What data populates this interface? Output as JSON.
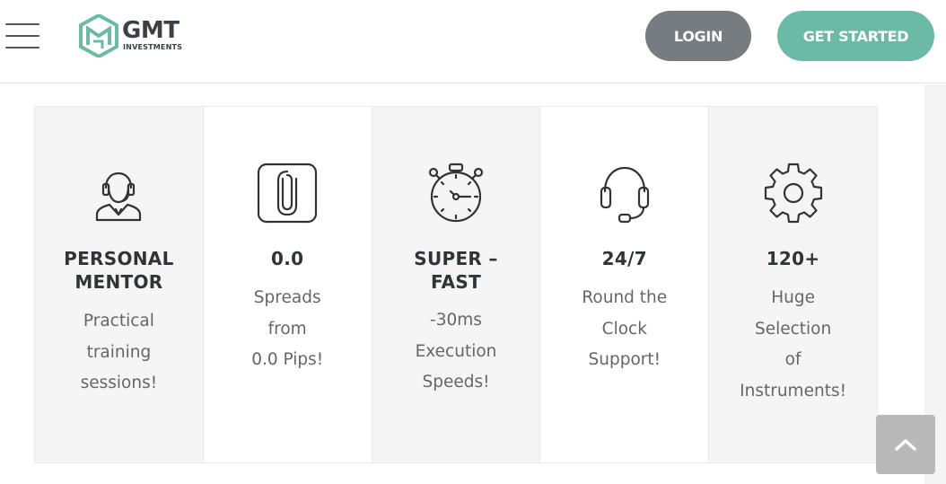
{
  "header": {
    "logo": {
      "name": "GMT",
      "subtitle": "INVESTMENTS",
      "icon": "gmt-hex-logo"
    },
    "menu_icon": "hamburger-menu-icon",
    "login_label": "LOGIN",
    "get_started_label": "GET STARTED"
  },
  "colors": {
    "brand": "#6abaa5",
    "login_button": "#767c7f",
    "panel_shade": "#f5f5f5",
    "scroll_button": "#b9b9b9"
  },
  "features": [
    {
      "icon": "headset-person-icon",
      "title": [
        "PERSONAL",
        "MENTOR"
      ],
      "desc": [
        "Practical",
        "training",
        "sessions!"
      ]
    },
    {
      "icon": "paperclip-icon",
      "title": [
        "0.0"
      ],
      "desc": [
        "Spreads",
        "from",
        "0.0 Pips!"
      ]
    },
    {
      "icon": "stopwatch-icon",
      "title": [
        "SUPER –",
        "FAST"
      ],
      "desc": [
        "-30ms",
        "Execution",
        "Speeds!"
      ]
    },
    {
      "icon": "headset-icon",
      "title": [
        "24/7"
      ],
      "desc": [
        "Round the",
        "Clock",
        "Support!"
      ]
    },
    {
      "icon": "gear-icon",
      "title": [
        "120+"
      ],
      "desc": [
        "Huge",
        "Selection",
        "of",
        "Instruments!"
      ]
    }
  ],
  "scroll_top_icon": "chevron-up-icon"
}
